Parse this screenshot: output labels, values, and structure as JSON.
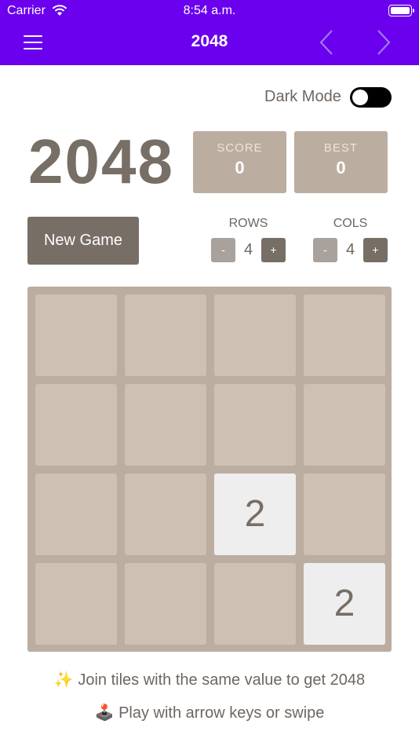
{
  "status_bar": {
    "carrier": "Carrier",
    "time": "8:54 a.m."
  },
  "nav": {
    "title": "2048",
    "menu_icon": "hamburger-menu-icon",
    "back_icon": "chevron-left-icon",
    "forward_icon": "chevron-right-icon"
  },
  "settings": {
    "dark_mode_label": "Dark Mode",
    "dark_mode_on": false
  },
  "game": {
    "title": "2048",
    "score_label": "SCORE",
    "score_value": "0",
    "best_label": "BEST",
    "best_value": "0",
    "new_game_label": "New Game"
  },
  "size": {
    "rows_label": "ROWS",
    "rows_value": "4",
    "cols_label": "COLS",
    "cols_value": "4",
    "minus": "-",
    "plus": "+"
  },
  "board": {
    "rows": 4,
    "cols": 4,
    "tiles": [
      {
        "row": 2,
        "col": 2,
        "value": "2"
      },
      {
        "row": 3,
        "col": 3,
        "value": "2"
      }
    ]
  },
  "hints": {
    "line1_emoji": "✨",
    "line1": " Join tiles with the same value to get 2048",
    "line2_emoji": "🕹️",
    "line2": " Play with arrow keys or swipe"
  },
  "colors": {
    "nav_bg": "#6a00ee",
    "board_bg": "#bbada0",
    "cell_bg": "#cdc1b4",
    "tile_2_bg": "#eeeeee",
    "text_dark": "#776e65"
  }
}
